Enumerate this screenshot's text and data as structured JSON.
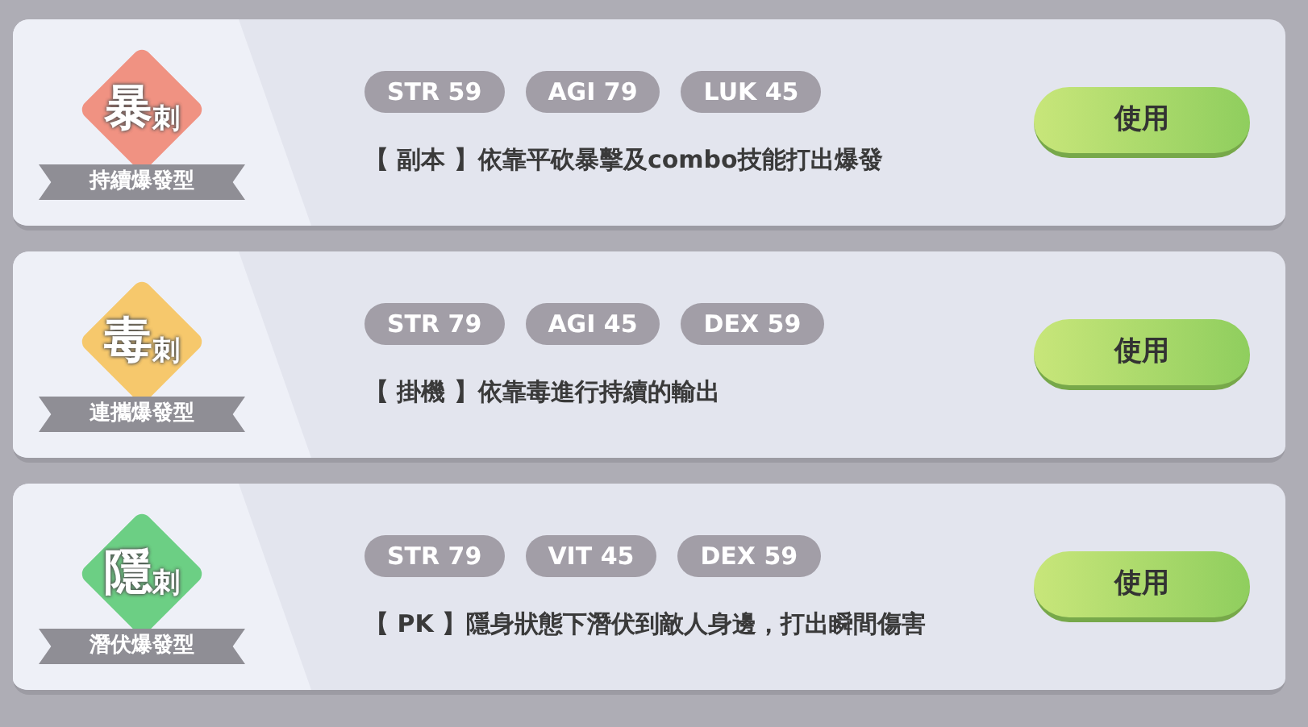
{
  "classes": [
    {
      "emblem_main": "暴",
      "emblem_sub": "刺",
      "color": "#f09282",
      "ribbon": "持續爆發型",
      "stats": [
        "STR 59",
        "AGI 79",
        "LUK 45"
      ],
      "description": "【 副本 】依靠平砍暴擊及combo技能打出爆發",
      "button": "使用"
    },
    {
      "emblem_main": "毒",
      "emblem_sub": "刺",
      "color": "#f6c86c",
      "ribbon": "連攜爆發型",
      "stats": [
        "STR 79",
        "AGI 45",
        "DEX 59"
      ],
      "description": "【 掛機 】依靠毒進行持續的輸出",
      "button": "使用"
    },
    {
      "emblem_main": "隱",
      "emblem_sub": "刺",
      "color": "#6ccf84",
      "ribbon": "潛伏爆發型",
      "stats": [
        "STR 79",
        "VIT 45",
        "DEX 59"
      ],
      "description": "【 PK 】隱身狀態下潛伏到敵人身邊，打出瞬間傷害",
      "button": "使用"
    }
  ]
}
